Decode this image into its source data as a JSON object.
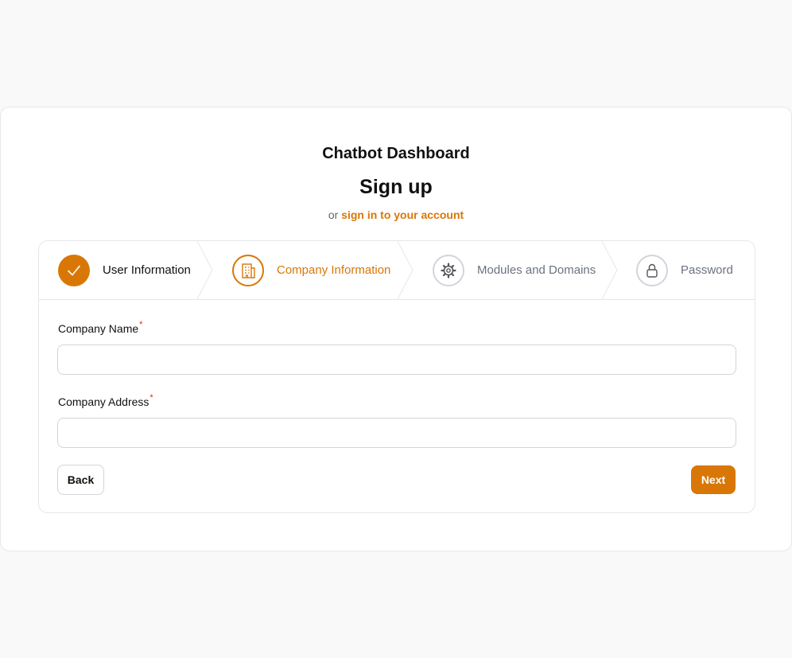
{
  "header": {
    "app_title": "Chatbot Dashboard",
    "page_title": "Sign up",
    "subtitle_prefix": "or",
    "signin_link": "sign in to your account"
  },
  "steps": [
    {
      "label": "User Information",
      "status": "done",
      "icon": "check-icon"
    },
    {
      "label": "Company Information",
      "status": "current",
      "icon": "building-icon"
    },
    {
      "label": "Modules and Domains",
      "status": "todo",
      "icon": "gear-icon"
    },
    {
      "label": "Password",
      "status": "todo",
      "icon": "lock-icon"
    }
  ],
  "form": {
    "company_name": {
      "label": "Company Name",
      "required_mark": "*",
      "value": "",
      "placeholder": ""
    },
    "company_address": {
      "label": "Company Address",
      "required_mark": "*",
      "value": "",
      "placeholder": ""
    }
  },
  "actions": {
    "back_label": "Back",
    "next_label": "Next"
  },
  "colors": {
    "accent": "#d97706",
    "required": "#dc2626",
    "border": "#d1d5db",
    "background": "#f9f9f9"
  }
}
